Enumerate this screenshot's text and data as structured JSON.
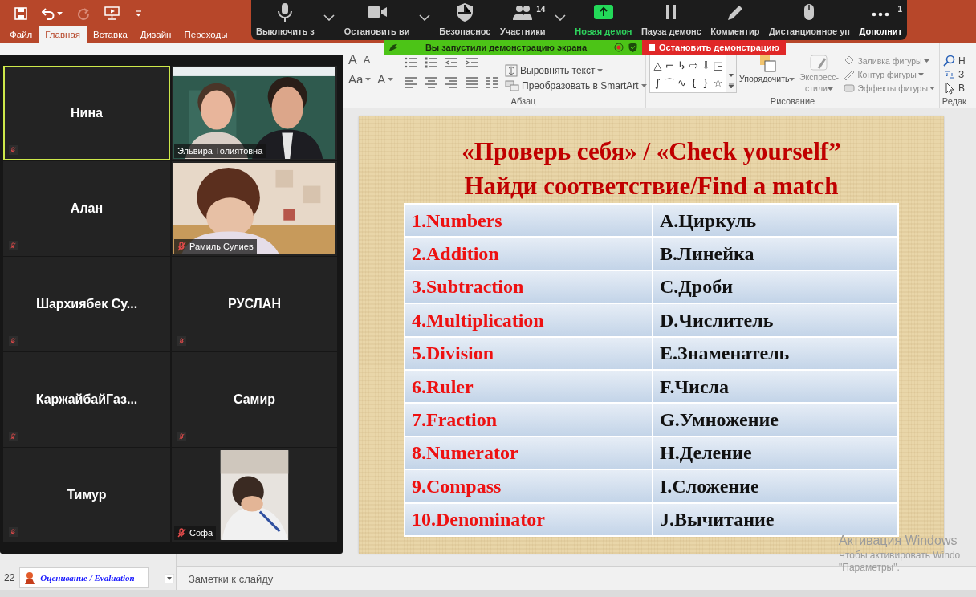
{
  "tabs": [
    {
      "label": "Файл",
      "selected": false
    },
    {
      "label": "Главная",
      "selected": true
    },
    {
      "label": "Вставка",
      "selected": false
    },
    {
      "label": "Дизайн",
      "selected": false
    },
    {
      "label": "Переходы",
      "selected": false
    }
  ],
  "ribbon": {
    "font_buttons": [
      "A",
      "A",
      "Aa",
      "A"
    ],
    "paragraph": {
      "commands": [
        "Выровнять текст",
        "Преобразовать в SmartArt"
      ],
      "label": "Абзац"
    },
    "drawing": {
      "shapes": [
        "△",
        "⌐",
        "↳",
        "⇨",
        "⇩",
        "◳",
        "∫",
        "⌒",
        "∿",
        "{",
        "}",
        "☆"
      ],
      "arrange": {
        "label": "Упорядочить",
        "disabled": false
      },
      "quick_styles": {
        "label": "Экспресс-стили",
        "disabled": true
      },
      "commands": [
        {
          "label": "Заливка фигуры",
          "disabled": true
        },
        {
          "label": "Контур фигуры",
          "disabled": true
        },
        {
          "label": "Эффекты фигуры",
          "disabled": true
        }
      ],
      "label": "Рисование"
    },
    "editing": {
      "commands": [
        "Н",
        "З",
        "В"
      ],
      "label": "Редак"
    }
  },
  "meeting_toolbar": [
    {
      "kind": "mic",
      "label": "Выключить з"
    },
    {
      "kind": "chevron"
    },
    {
      "kind": "camera",
      "label": "Остановить ви"
    },
    {
      "kind": "chevron"
    },
    {
      "kind": "shield",
      "label": "Безопаснос"
    },
    {
      "kind": "participants",
      "label": "Участники",
      "badge": "14"
    },
    {
      "kind": "chevron"
    },
    {
      "kind": "share",
      "label": "Новая демон"
    },
    {
      "kind": "pause",
      "label": "Пауза демонс"
    },
    {
      "kind": "pen",
      "label": "Комментир"
    },
    {
      "kind": "mouse",
      "label": "Дистанционное уп"
    },
    {
      "kind": "more",
      "label": "Дополнит",
      "badge": "1"
    }
  ],
  "share_bar": {
    "status": "Вы запустили демонстрацию экрана",
    "stop": "Остановить демонстрацию"
  },
  "gallery": [
    {
      "name": "Нина",
      "kind": "avatar",
      "muted": true,
      "selected": true
    },
    {
      "name": "Эльвира Толиятовна",
      "kind": "video",
      "muted": false,
      "selected": false
    },
    {
      "name": "Алан",
      "kind": "avatar",
      "muted": true,
      "selected": false
    },
    {
      "name": "Рамиль Сулиев",
      "kind": "video",
      "muted": true,
      "selected": false
    },
    {
      "name": "Шархиябек Су...",
      "kind": "avatar",
      "muted": true,
      "selected": false
    },
    {
      "name": "РУСЛАН",
      "kind": "avatar",
      "muted": true,
      "selected": false
    },
    {
      "name": "КаржайбайГаз...",
      "kind": "avatar",
      "muted": true,
      "selected": false
    },
    {
      "name": "Самир",
      "kind": "avatar",
      "muted": true,
      "selected": false
    },
    {
      "name": "Тимур",
      "kind": "avatar",
      "muted": true,
      "selected": false
    },
    {
      "name": "Софа",
      "kind": "video",
      "muted": true,
      "selected": false
    }
  ],
  "slide": {
    "title": [
      "«Проверь себя» / «Check yourself”",
      "Найди соответствие/Find a match"
    ],
    "rows": [
      {
        "term": "1.Numbers",
        "match": "A.Циркуль"
      },
      {
        "term": "2.Addition",
        "match": "B.Линейка"
      },
      {
        "term": "3.Subtraction",
        "match": "C.Дроби"
      },
      {
        "term": "4.Multiplication",
        "match": "D.Числитель"
      },
      {
        "term": "5.Division",
        "match": "E.Знаменатель"
      },
      {
        "term": "6.Ruler",
        "match": "F.Числа"
      },
      {
        "term": "7.Fraction",
        "match": "G.Умножение"
      },
      {
        "term": "8.Numerator",
        "match": "H.Деление"
      },
      {
        "term": "9.Compass",
        "match": "I.Сложение"
      },
      {
        "term": "10.Denominator",
        "match": "J.Вычитание"
      }
    ]
  },
  "thumbnail": {
    "number": "22",
    "title": "Оценивание / Evaluation"
  },
  "notes": {
    "placeholder": "Заметки к слайду"
  },
  "activation": [
    "Активация Windows",
    "Чтобы активировать Windo",
    "\"Параметры\"."
  ]
}
